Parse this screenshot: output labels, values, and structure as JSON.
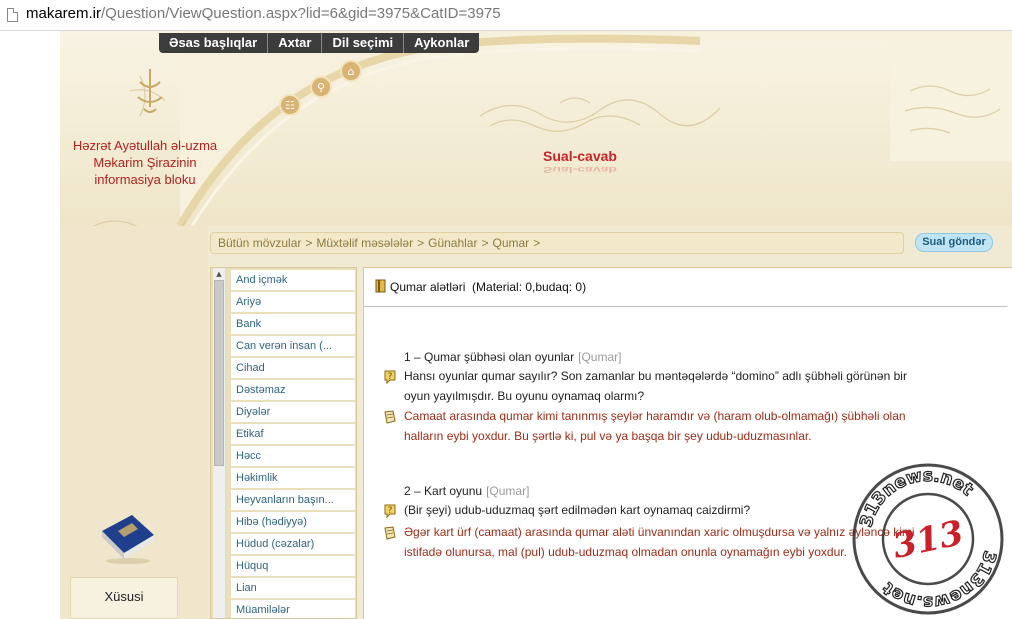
{
  "browser": {
    "url_host": "makarem.ir",
    "url_path": "/Question/ViewQuestion.aspx?lid=6&gid=3975&CatID=3975"
  },
  "topnav": {
    "items": [
      "Əsas başlıqlar",
      "Axtar",
      "Dil seçimi",
      "Aykonlar"
    ]
  },
  "header": {
    "site_name_lines": [
      "Həzrət Ayətullah əl-uzma",
      "Məkarim Şirazinin",
      "informasiya bloku"
    ],
    "section_title": "Sual-cavab"
  },
  "breadcrumb": {
    "items": [
      "Bütün mövzular",
      "Müxtəlif məsələlər",
      "Günahlar",
      "Qumar"
    ],
    "separator": ">",
    "trailing": ">"
  },
  "send_button": "Sual göndər",
  "sidebar": {
    "items": [
      "And içmək",
      "Ariyə",
      "Bank",
      "Can verən insan (...",
      "Cihad",
      "Dəstəmaz",
      "Diyələr",
      "Etikaf",
      "Həcc",
      "Həkimlik",
      "Heyvanların başın...",
      "Hibə (hədiyyə)",
      "Hüdud (cəzalar)",
      "Hüquq",
      "Lian",
      "Müamilələr"
    ],
    "special_label": "Xüsusi"
  },
  "content": {
    "material_title": "Qumar alətləri",
    "material_meta": "(Material: 0,budaq: 0)",
    "questions": [
      {
        "title": "1 – Qumar şübhəsi olan oyunlar",
        "tag": "[Qumar]",
        "question_lines": [
          "Hansı oyunlar qumar sayılır? Son zamanlar bu məntəqələrdə “domino” adlı şübhəli görünən bir",
          "oyun yayılmışdır. Bu oyunu oynamaq olarmı?"
        ],
        "answer_lines": [
          "Camaat arasında qumar kimi tanınmış şeylər haramdır və (haram olub-olmamağı) şübhəli olan",
          "halların eybi yoxdur. Bu şərtlə ki, pul və ya başqa bir şey udub-uduzmasınlar."
        ]
      },
      {
        "title": "2 – Kart oyunu",
        "tag": "[Qumar]",
        "question_lines": [
          "(Bir şeyi) udub-uduzmaq şərt edilmədən kart oynamaq caizdirmi?"
        ],
        "answer_lines": [
          "Əgər kart ürf (camaat) arasında qumar aləti ünvanından xaric olmuşdursa və yalnız əyləncə kimi",
          "istifadə olunursa, mal (pul) udub-uduzmaq olmadan onunla oynamağın eybi yoxdur."
        ]
      }
    ]
  },
  "watermark": {
    "number": "313",
    "text": "313news.net"
  },
  "colors": {
    "brand_red": "#b2221f",
    "answer_red": "#9d2b16",
    "sidebar_link": "#2f6580",
    "nav_dark": "#3c3c3c",
    "page_bg": "#f4efdd"
  }
}
